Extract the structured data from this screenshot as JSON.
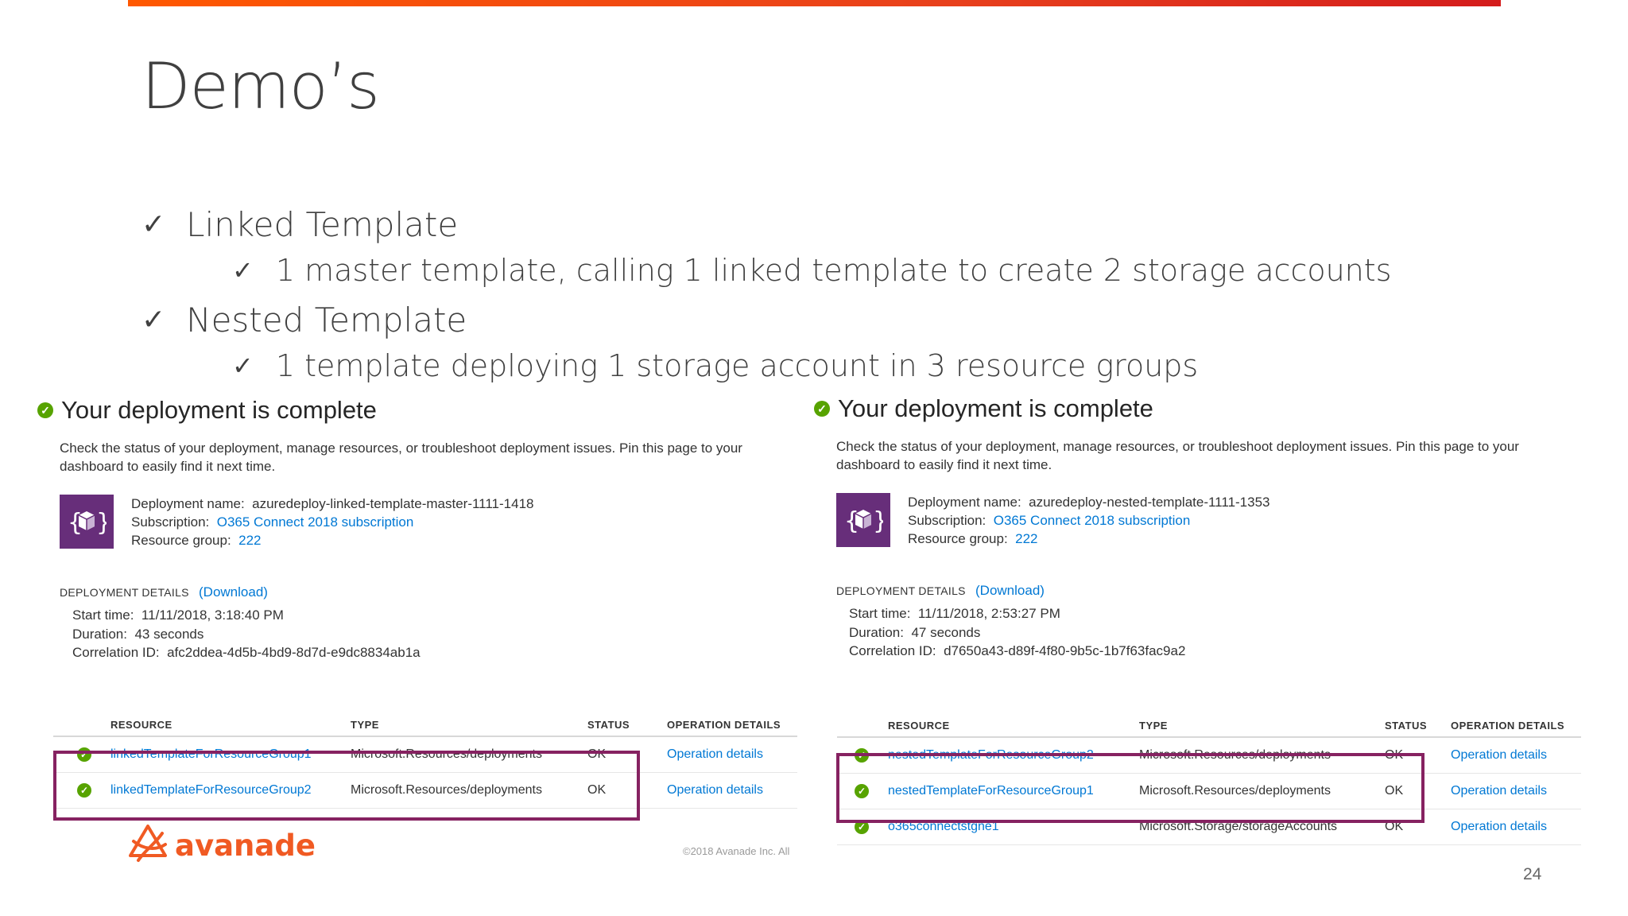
{
  "slide": {
    "title": "Demo’s",
    "bullets": [
      {
        "level": 1,
        "text": "Linked Template"
      },
      {
        "level": 2,
        "text": "1 master template, calling 1 linked template to create 2 storage accounts"
      },
      {
        "level": 1,
        "text": "Nested Template"
      },
      {
        "level": 2,
        "text": "1 template deploying 1 storage account in 3 resource groups"
      }
    ],
    "check_glyph": "✓",
    "copyright": "©2018 Avanade Inc. All",
    "page_number": "24",
    "logo_text": "avanade"
  },
  "panel_left": {
    "title": "Your deployment is complete",
    "description": "Check the status of your deployment, manage resources, or troubleshoot deployment issues. Pin this page to your dashboard to easily find it next time.",
    "deployment_name_label": "Deployment name:",
    "deployment_name": "azuredeploy-linked-template-master-1111-1418",
    "subscription_label": "Subscription:",
    "subscription": "O365 Connect 2018 subscription",
    "resource_group_label": "Resource group:",
    "resource_group": "222",
    "details_heading": "DEPLOYMENT DETAILS",
    "download_link": "(Download)",
    "start_time_label": "Start time:",
    "start_time": "11/11/2018, 3:18:40 PM",
    "duration_label": "Duration:",
    "duration": "43 seconds",
    "correlation_label": "Correlation ID:",
    "correlation_id": "afc2ddea-4d5b-4bd9-8d7d-e9dc8834ab1a",
    "columns": [
      "RESOURCE",
      "TYPE",
      "STATUS",
      "OPERATION DETAILS"
    ],
    "rows": [
      {
        "resource": "linkedTemplateForResourceGroup1",
        "type": "Microsoft.Resources/deployments",
        "status": "OK",
        "details": "Operation details"
      },
      {
        "resource": "linkedTemplateForResourceGroup2",
        "type": "Microsoft.Resources/deployments",
        "status": "OK",
        "details": "Operation details"
      }
    ]
  },
  "panel_right": {
    "title": "Your deployment is complete",
    "description": "Check the status of your deployment, manage resources, or troubleshoot deployment issues. Pin this page to your dashboard to easily find it next time.",
    "deployment_name_label": "Deployment name:",
    "deployment_name": "azuredeploy-nested-template-1111-1353",
    "subscription_label": "Subscription:",
    "subscription": "O365 Connect 2018 subscription",
    "resource_group_label": "Resource group:",
    "resource_group": "222",
    "details_heading": "DEPLOYMENT DETAILS",
    "download_link": "(Download)",
    "start_time_label": "Start time:",
    "start_time": "11/11/2018, 2:53:27 PM",
    "duration_label": "Duration:",
    "duration": "47 seconds",
    "correlation_label": "Correlation ID:",
    "correlation_id": "d7650a43-d89f-4f80-9b5c-1b7f63fac9a2",
    "columns": [
      "RESOURCE",
      "TYPE",
      "STATUS",
      "OPERATION DETAILS"
    ],
    "rows": [
      {
        "resource": "nestedTemplateForResourceGroup2",
        "type": "Microsoft.Resources/deployments",
        "status": "OK",
        "details": "Operation details"
      },
      {
        "resource": "nestedTemplateForResourceGroup1",
        "type": "Microsoft.Resources/deployments",
        "status": "OK",
        "details": "Operation details"
      },
      {
        "resource": "o365connectstgne1",
        "type": "Microsoft.Storage/storageAccounts",
        "status": "OK",
        "details": "Operation details"
      }
    ]
  },
  "colors": {
    "accent_orange": "#ff5800",
    "status_ok": "#57a300",
    "link_blue": "#0078d4",
    "highlight_border": "#862261",
    "deployment_icon_bg": "#672e7a"
  },
  "icons": {
    "status": "check-circle-icon",
    "deployment": "cube-braces-icon",
    "logo": "avanade-logo-icon"
  }
}
